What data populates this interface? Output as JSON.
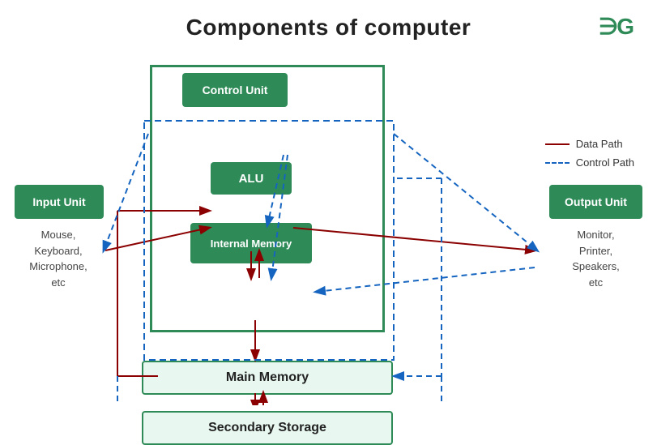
{
  "title": "Components of computer",
  "logo": "∋G",
  "legend": {
    "data_path": "Data Path",
    "control_path": "Control Path"
  },
  "boxes": {
    "control_unit": "Control Unit",
    "alu": "ALU",
    "internal_memory": "Internal Memory",
    "main_memory": "Main Memory",
    "secondary_storage": "Secondary Storage",
    "input_unit": "Input Unit",
    "output_unit": "Output Unit"
  },
  "labels": {
    "input_devices": "Mouse,\nKeyboard,\nMicrophone,\netc",
    "output_devices": "Monitor,\nPrinter,\nSpeakers,\netc"
  }
}
